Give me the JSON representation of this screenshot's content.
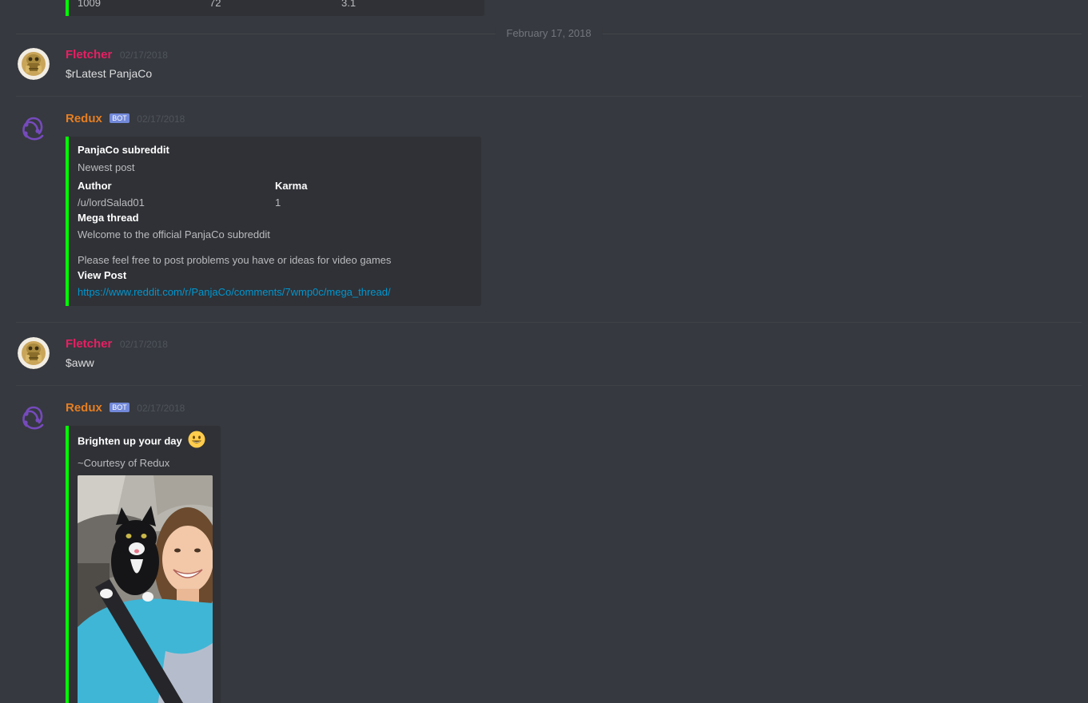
{
  "top_embed": {
    "cells": [
      "1009",
      "72",
      "3.1"
    ]
  },
  "date_divider": "February 17, 2018",
  "messages": [
    {
      "username": "Fletcher",
      "timestamp": "02/17/2018",
      "text": "$rLatest PanjaCo"
    },
    {
      "username": "Redux",
      "bot_tag": "BOT",
      "timestamp": "02/17/2018",
      "embed": {
        "title": "PanjaCo subreddit",
        "description": "Newest post",
        "fields": [
          {
            "name": "Author",
            "value": "/u/lordSalad01"
          },
          {
            "name": "Karma",
            "value": "1"
          },
          {
            "name": "Mega thread",
            "value": "Welcome to the official PanjaCo subreddit",
            "value2": "Please feel free to post problems you have or ideas for video games"
          },
          {
            "name": "View Post",
            "value": "https://www.reddit.com/r/PanjaCo/comments/7wmp0c/mega_thread/"
          }
        ]
      }
    },
    {
      "username": "Fletcher",
      "timestamp": "02/17/2018",
      "text": "$aww"
    },
    {
      "username": "Redux",
      "bot_tag": "BOT",
      "timestamp": "02/17/2018",
      "embed": {
        "title": "Brighten up your day",
        "title_emoji": "smiley-emoji",
        "description": "~Courtesy of Redux",
        "image": "girl-with-cat-in-car-photo"
      }
    }
  ],
  "colors": {
    "background": "#36393f",
    "embed_background": "#2f3136",
    "embed_border": "#00ff00",
    "fletcher": "#e91e63",
    "redux": "#e67e22",
    "bot_tag": "#7289da",
    "link": "#0096cf"
  }
}
